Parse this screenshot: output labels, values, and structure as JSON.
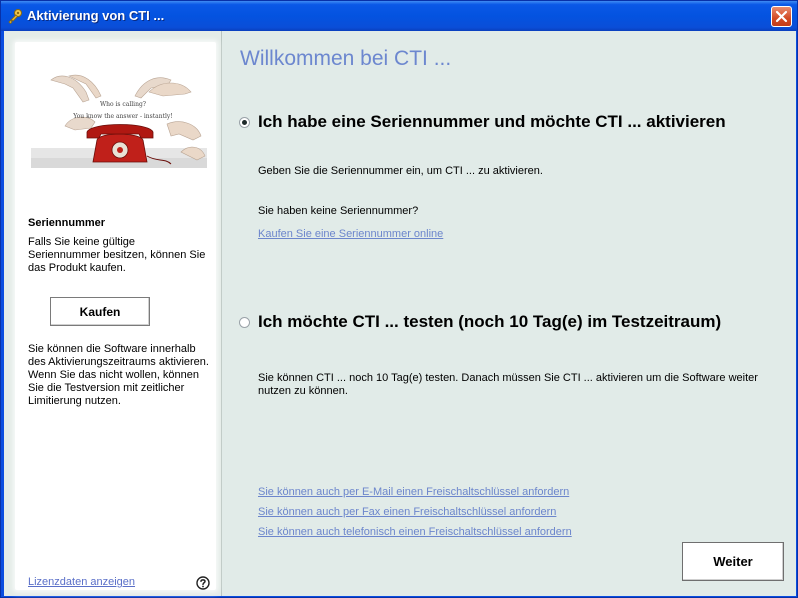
{
  "window": {
    "title": "Aktivierung von CTI ..."
  },
  "sidebar": {
    "image_caption_1": "Who is calling?",
    "image_caption_2": "You know the answer - instantly!",
    "heading": "Seriennummer",
    "text1": "Falls Sie keine gültige Seriennummer besitzen, können Sie das Produkt kaufen.",
    "buy_label": "Kaufen",
    "text2": "Sie können die Software innerhalb des Aktivierungszeitraums aktivieren. Wenn Sie das nicht wollen, können Sie die Testversion mit zeitlicher Limitierung nutzen.",
    "license_link": "Lizenzdaten anzeigen",
    "help_icon": "help-icon"
  },
  "main": {
    "welcome": "Willkommen bei CTI ...",
    "option1": {
      "label": "Ich habe eine Seriennummer und möchte CTI ... aktivieren",
      "selected": true,
      "text": "Geben Sie die Seriennummer ein, um CTI ... zu aktivieren.",
      "no_serial": "Sie haben keine Seriennummer?",
      "buy_link": "Kaufen Sie eine Seriennummer online"
    },
    "option2": {
      "label": "Ich möchte CTI ... testen (noch 10 Tag(e) im Testzeitraum)",
      "selected": false,
      "text": "Sie können CTI ... noch 10 Tag(e) testen. Danach müssen Sie CTI ... aktivieren um die Software weiter nutzen zu können."
    },
    "links": [
      "Sie können auch per E-Mail einen Freischaltschlüssel anfordern",
      "Sie können auch per Fax einen Freischaltschlüssel anfordern",
      "Sie können auch telefonisch einen Freischaltschlüssel anfordern"
    ],
    "next_label": "Weiter"
  },
  "colors": {
    "titlebar": "#0453e0",
    "link": "#6c86cc",
    "heading": "#6c87cf",
    "main_bg": "#e1ebe8"
  }
}
